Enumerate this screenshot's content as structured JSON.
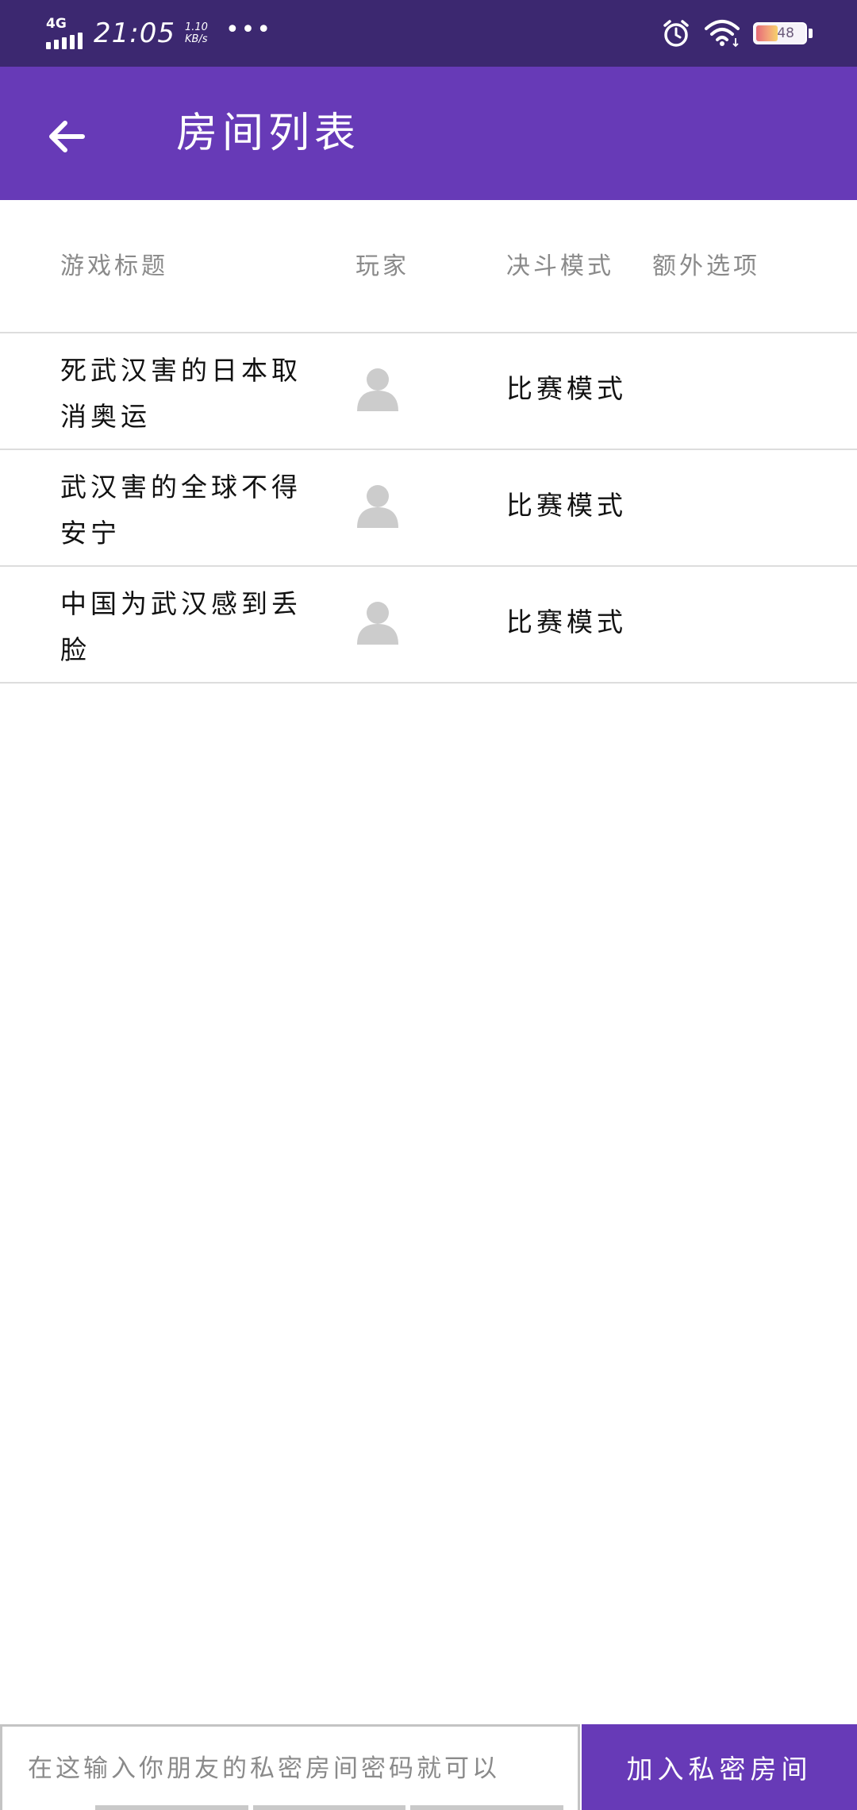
{
  "status_bar": {
    "network": "4G",
    "time": "21:05",
    "net_speed_value": "1.10",
    "net_speed_unit": "KB/s",
    "more": "•••",
    "battery_percent": "48",
    "battery_level": 0.48,
    "icons": [
      "signal-icon",
      "alarm-icon",
      "wifi-icon",
      "battery-icon"
    ]
  },
  "app_bar": {
    "back_icon": "arrow-left-icon",
    "title": "房间列表"
  },
  "table": {
    "headers": {
      "title": "游戏标题",
      "players": "玩家",
      "mode": "决斗模式",
      "extra": "额外选项"
    },
    "rows": [
      {
        "title": "死武汉害的日本取消奥运",
        "player_icon": "person-icon",
        "mode": "比赛模式",
        "extra": ""
      },
      {
        "title": "武汉害的全球不得安宁",
        "player_icon": "person-icon",
        "mode": "比赛模式",
        "extra": ""
      },
      {
        "title": "中国为武汉感到丢脸",
        "player_icon": "person-icon",
        "mode": "比赛模式",
        "extra": ""
      }
    ]
  },
  "bottom_bar": {
    "password_placeholder": "在这输入你朋友的私密房间密码就可以",
    "password_value": "",
    "join_label": "加入私密房间"
  },
  "colors": {
    "status_bar": "#3c2870",
    "primary": "#673ab7",
    "header_text": "#8a8a8a",
    "divider": "#dddddd",
    "avatar": "#cccccc"
  }
}
